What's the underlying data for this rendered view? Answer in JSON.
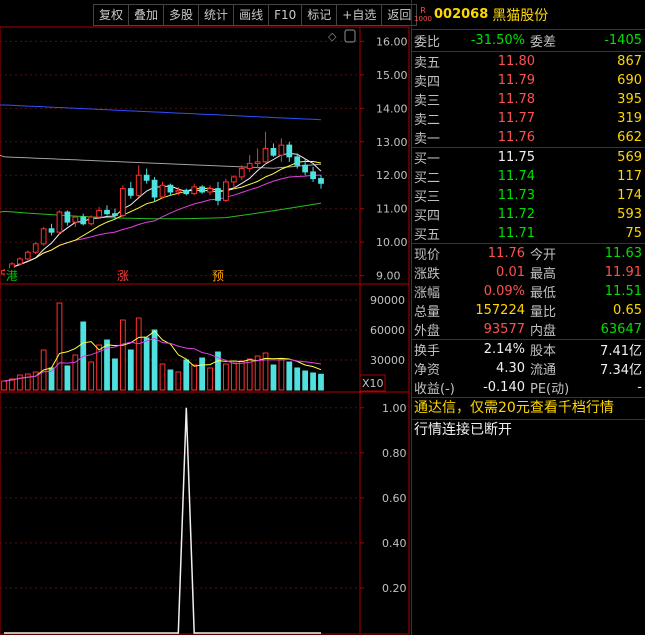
{
  "toolbar": [
    "复权",
    "叠加",
    "多股",
    "统计",
    "画线",
    "F10",
    "标记",
    "+自选",
    "返回"
  ],
  "header": {
    "badge_top": "R",
    "badge_bottom": "1000",
    "code": "002068",
    "name": "黑猫股份"
  },
  "price_axis": [
    "16.00",
    "15.00",
    "14.00",
    "13.00",
    "12.00",
    "11.00",
    "10.00",
    "9.00"
  ],
  "volume_axis": [
    "90000",
    "60000",
    "30000"
  ],
  "volume_unit": "X10",
  "indicator_axis": [
    "1.00",
    "0.80",
    "0.60",
    "0.40",
    "0.20"
  ],
  "markers": [
    {
      "text": "港",
      "color": "#00c000",
      "bar": 1
    },
    {
      "text": "涨",
      "color": "#ff4040",
      "bar": 15
    },
    {
      "text": "预",
      "color": "#ffa500",
      "bar": 27
    }
  ],
  "quote": {
    "weibi_label": "委比",
    "weibi": "-31.50%",
    "weicha_label": "委差",
    "weicha": "-1405",
    "sell": [
      {
        "label": "卖五",
        "price": "11.80",
        "vol": "867"
      },
      {
        "label": "卖四",
        "price": "11.79",
        "vol": "690"
      },
      {
        "label": "卖三",
        "price": "11.78",
        "vol": "395"
      },
      {
        "label": "卖二",
        "price": "11.77",
        "vol": "319"
      },
      {
        "label": "卖一",
        "price": "11.76",
        "vol": "662"
      }
    ],
    "buy": [
      {
        "label": "买一",
        "price": "11.75",
        "vol": "569"
      },
      {
        "label": "买二",
        "price": "11.74",
        "vol": "117"
      },
      {
        "label": "买三",
        "price": "11.73",
        "vol": "174"
      },
      {
        "label": "买四",
        "price": "11.72",
        "vol": "593"
      },
      {
        "label": "买五",
        "price": "11.71",
        "vol": "75"
      }
    ],
    "stats1": [
      {
        "l1": "现价",
        "v1": "11.76",
        "c1": "red",
        "l2": "今开",
        "v2": "11.63",
        "c2": "green"
      },
      {
        "l1": "涨跌",
        "v1": "0.01",
        "c1": "red",
        "l2": "最高",
        "v2": "11.91",
        "c2": "red"
      },
      {
        "l1": "涨幅",
        "v1": "0.09%",
        "c1": "red",
        "l2": "最低",
        "v2": "11.51",
        "c2": "green"
      },
      {
        "l1": "总量",
        "v1": "157224",
        "c1": "yellow",
        "l2": "量比",
        "v2": "0.65",
        "c2": "yellow"
      },
      {
        "l1": "外盘",
        "v1": "93577",
        "c1": "red",
        "l2": "内盘",
        "v2": "63647",
        "c2": "green"
      }
    ],
    "stats2": [
      {
        "l1": "换手",
        "v1": "2.14%",
        "l2": "股本",
        "v2": "7.41亿"
      },
      {
        "l1": "净资",
        "v1": "4.30",
        "l2": "流通",
        "v2": "7.34亿"
      },
      {
        "l1": "收益(-)",
        "v1": "-0.140",
        "l2": "PE(动)",
        "v2": "-"
      }
    ],
    "ad_text": "通达信，仅需20元查看千档行情",
    "status_text": "行情连接已断开"
  },
  "chart_data": {
    "type": "candlestick",
    "candles": [
      [
        9.05,
        9.2,
        9.0,
        9.15
      ],
      [
        9.15,
        9.4,
        9.1,
        9.35
      ],
      [
        9.35,
        9.55,
        9.3,
        9.5
      ],
      [
        9.5,
        9.75,
        9.45,
        9.7
      ],
      [
        9.7,
        10.0,
        9.65,
        9.95
      ],
      [
        9.95,
        10.45,
        9.9,
        10.4
      ],
      [
        10.4,
        10.55,
        10.2,
        10.3
      ],
      [
        10.3,
        10.95,
        10.25,
        10.9
      ],
      [
        10.9,
        10.95,
        10.5,
        10.6
      ],
      [
        10.6,
        10.8,
        10.45,
        10.75
      ],
      [
        10.75,
        10.85,
        10.5,
        10.55
      ],
      [
        10.55,
        10.8,
        10.5,
        10.75
      ],
      [
        10.75,
        11.05,
        10.7,
        10.95
      ],
      [
        10.95,
        11.1,
        10.8,
        10.85
      ],
      [
        10.85,
        11.0,
        10.7,
        10.8
      ],
      [
        10.8,
        11.7,
        10.75,
        11.6
      ],
      [
        11.6,
        11.8,
        11.3,
        11.4
      ],
      [
        11.4,
        12.3,
        11.35,
        12.0
      ],
      [
        12.0,
        12.2,
        11.75,
        11.85
      ],
      [
        11.85,
        11.95,
        11.2,
        11.35
      ],
      [
        11.35,
        11.8,
        11.3,
        11.7
      ],
      [
        11.7,
        11.75,
        11.4,
        11.5
      ],
      [
        11.5,
        11.65,
        11.4,
        11.55
      ],
      [
        11.55,
        11.6,
        11.4,
        11.45
      ],
      [
        11.45,
        11.75,
        11.4,
        11.65
      ],
      [
        11.65,
        11.7,
        11.45,
        11.5
      ],
      [
        11.5,
        11.7,
        11.4,
        11.6
      ],
      [
        11.6,
        11.8,
        11.1,
        11.25
      ],
      [
        11.25,
        11.9,
        11.2,
        11.8
      ],
      [
        11.8,
        12.0,
        11.6,
        11.95
      ],
      [
        11.95,
        12.3,
        11.85,
        12.2
      ],
      [
        12.2,
        12.6,
        12.1,
        12.35
      ],
      [
        12.35,
        12.8,
        12.2,
        12.4
      ],
      [
        12.4,
        13.3,
        12.3,
        12.8
      ],
      [
        12.8,
        12.95,
        12.55,
        12.6
      ],
      [
        12.6,
        13.1,
        12.4,
        12.9
      ],
      [
        12.9,
        13.0,
        12.4,
        12.55
      ],
      [
        12.55,
        12.65,
        12.2,
        12.3
      ],
      [
        12.3,
        12.5,
        12.0,
        12.1
      ],
      [
        12.1,
        12.25,
        11.8,
        11.9
      ],
      [
        11.9,
        12.0,
        11.6,
        11.76
      ]
    ],
    "volumes": [
      9000,
      11000,
      15000,
      16000,
      18000,
      40000,
      22000,
      87000,
      24000,
      35000,
      68000,
      28000,
      45000,
      50000,
      31000,
      70000,
      40000,
      72000,
      52000,
      60000,
      26000,
      20000,
      18000,
      30000,
      25000,
      32000,
      22000,
      38000,
      26000,
      27000,
      29000,
      31000,
      34000,
      37000,
      25000,
      31000,
      28000,
      22000,
      19000,
      17000,
      15722
    ],
    "indicator": {
      "spike_bar": 23,
      "spike_value": 1.0
    },
    "price_range": [
      8.75,
      16.4
    ],
    "volume_range": [
      0,
      100000
    ],
    "indicator_range": [
      0,
      1.07
    ]
  }
}
